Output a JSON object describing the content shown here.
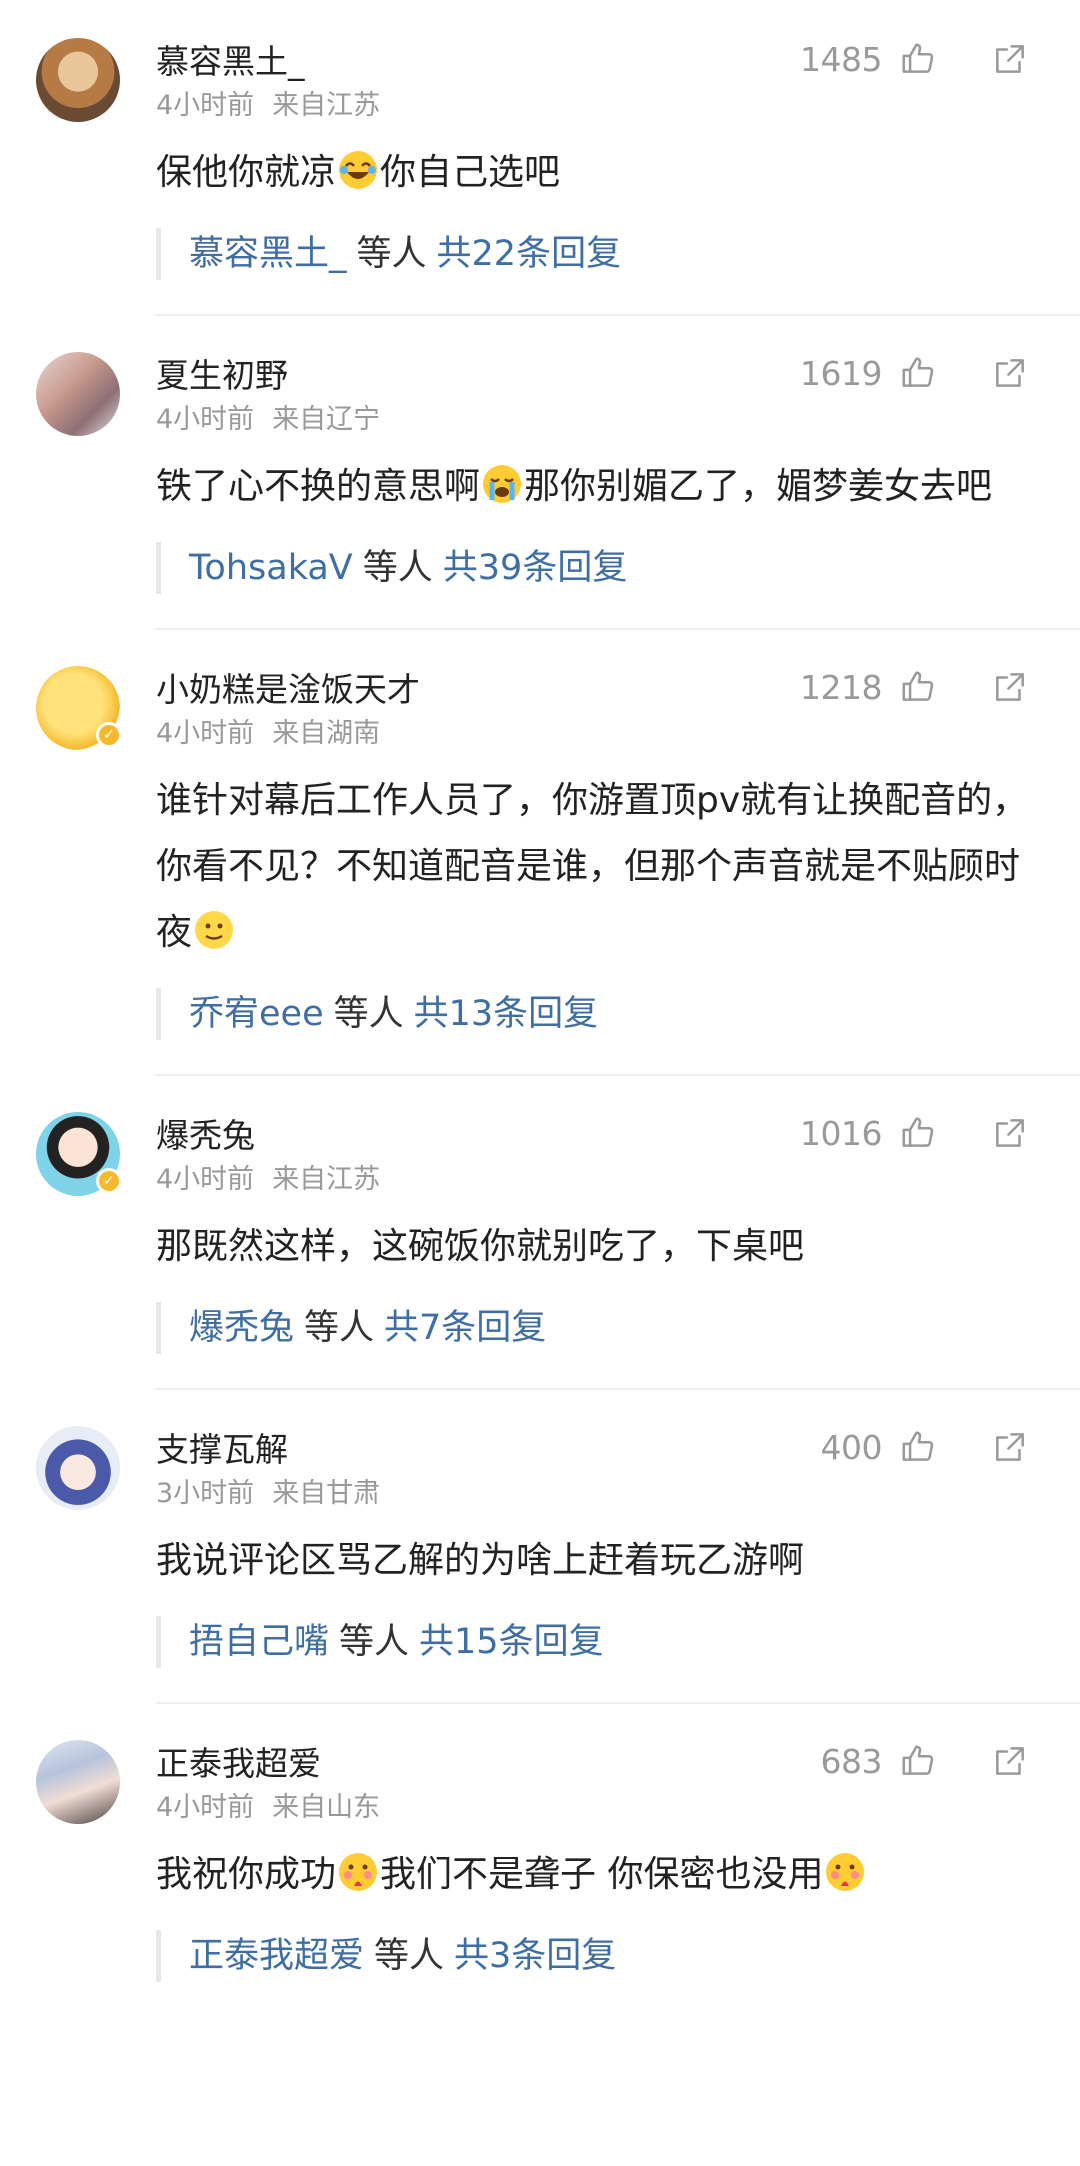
{
  "colors": {
    "link": "#3e6ea3",
    "meta": "#999999",
    "text": "#222222",
    "divider": "#eeeeee"
  },
  "icons": {
    "like": "thumbs-up-icon",
    "share": "share-icon"
  },
  "comments": [
    {
      "username": "慕容黑土_",
      "likes": "1485",
      "time": "4小时前",
      "location": "来自江苏",
      "text_parts": [
        "保他你就凉",
        "你自己选吧"
      ],
      "emoji": [
        "laugh-cry-emoji"
      ],
      "reply_user": "慕容黑土_",
      "reply_etc": "等人",
      "reply_total": "共22条回复"
    },
    {
      "username": "夏生初野",
      "likes": "1619",
      "time": "4小时前",
      "location": "来自辽宁",
      "text_parts": [
        "铁了心不换的意思啊",
        "那你别媚乙了，媚梦姜女去吧"
      ],
      "emoji": [
        "sob-emoji"
      ],
      "reply_user": "TohsakaV",
      "reply_etc": "等人",
      "reply_total": "共39条回复"
    },
    {
      "username": "小奶糕是淦饭天才",
      "likes": "1218",
      "time": "4小时前",
      "location": "来自湖南",
      "text_parts": [
        "谁针对幕后工作人员了，你游置顶pv就有让换配音的，你看不见？不知道配音是谁，但那个声音就是不贴顾时夜",
        ""
      ],
      "emoji": [
        "smile-emoji"
      ],
      "reply_user": "乔宥eee",
      "reply_etc": "等人",
      "reply_total": "共13条回复"
    },
    {
      "username": "爆秃兔",
      "likes": "1016",
      "time": "4小时前",
      "location": "来自江苏",
      "text_parts": [
        "那既然这样，这碗饭你就别吃了，下桌吧"
      ],
      "emoji": [],
      "reply_user": "爆秃兔",
      "reply_etc": "等人",
      "reply_total": "共7条回复"
    },
    {
      "username": "支撑瓦解",
      "likes": "400",
      "time": "3小时前",
      "location": "来自甘肃",
      "text_parts": [
        "我说评论区骂乙解的为啥上赶着玩乙游啊"
      ],
      "emoji": [],
      "reply_user": "捂自己嘴",
      "reply_etc": "等人",
      "reply_total": "共15条回复"
    },
    {
      "username": "正泰我超爱",
      "likes": "683",
      "time": "4小时前",
      "location": "来自山东",
      "text_parts": [
        "我祝你成功",
        "我们不是聋子 你保密也没用",
        ""
      ],
      "emoji": [
        "shy-emoji",
        "shy-emoji"
      ],
      "reply_user": "正泰我超爱",
      "reply_etc": "等人",
      "reply_total": "共3条回复"
    }
  ]
}
